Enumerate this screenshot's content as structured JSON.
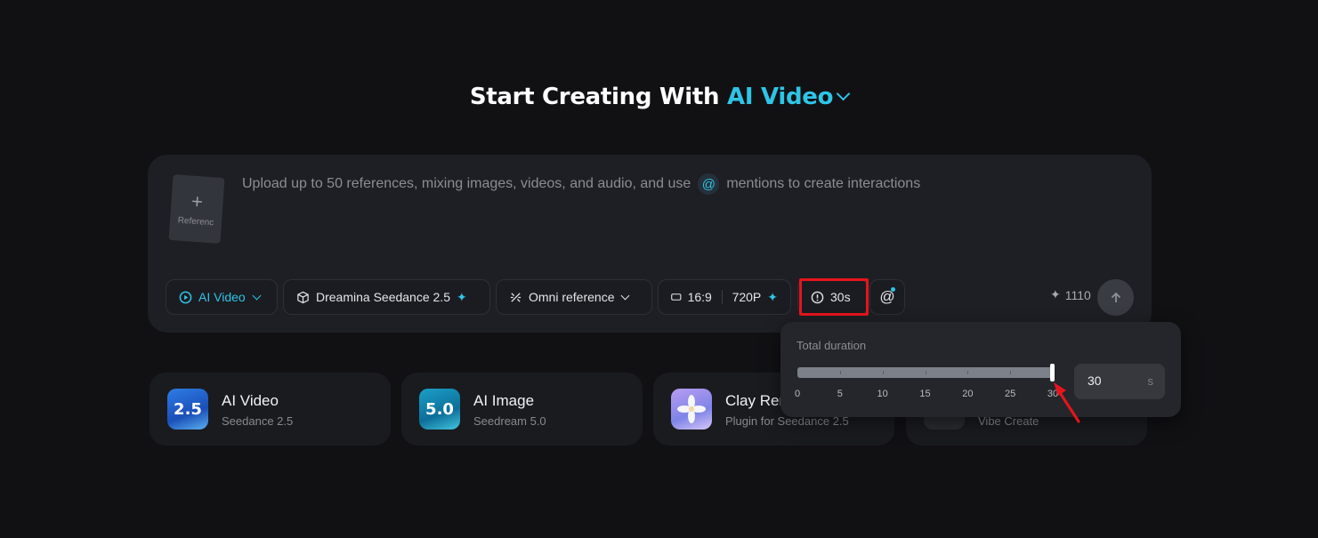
{
  "header": {
    "prefix": "Start Creating With",
    "accent": "AI Video"
  },
  "composer": {
    "reference_label": "Referenc",
    "prompt_before": "Upload up to 50 references, mixing images, videos, and audio, and use",
    "mention_symbol": "@",
    "prompt_after": "mentions to create interactions"
  },
  "toolbar": {
    "mode_label": "AI Video",
    "model_label": "Dreamina Seedance 2.5",
    "reference_mode": "Omni reference",
    "aspect_ratio": "16:9",
    "resolution": "720P",
    "duration": "30s",
    "mention_button": "@",
    "credits": "1110"
  },
  "duration_popover": {
    "label": "Total duration",
    "value": 30,
    "min": 0,
    "max": 30,
    "ticks": [
      "0",
      "5",
      "10",
      "15",
      "20",
      "25",
      "30"
    ],
    "input_value": "30",
    "unit": "s"
  },
  "cards": [
    {
      "title": "AI Video",
      "subtitle": "Seedance 2.5",
      "badge": "2.5"
    },
    {
      "title": "AI Image",
      "subtitle": "Seedream 5.0",
      "badge": "5.0"
    },
    {
      "title": "Clay Ren",
      "subtitle": "Plugin for Seedance 2.5",
      "badge": ""
    },
    {
      "title": "",
      "subtitle": "Vibe Create",
      "badge": ""
    }
  ],
  "colors": {
    "accent": "#2ec4e6",
    "background": "#111114",
    "highlight": "#e8141c"
  }
}
